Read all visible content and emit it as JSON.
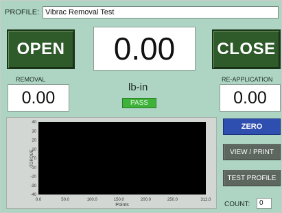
{
  "profile": {
    "label": "PROFILE:",
    "value": "Vibrac Removal Test"
  },
  "buttons": {
    "open": "OPEN",
    "close": "CLOSE",
    "zero": "ZERO",
    "view_print": "VIEW / PRINT",
    "test_profile": "TEST PROFILE"
  },
  "main_display": {
    "value": "0.00"
  },
  "removal": {
    "label": "REMOVAL",
    "value": "0.00"
  },
  "reapplication": {
    "label": "RE-APPLICATION",
    "value": "0.00"
  },
  "unit": "lb-in",
  "status": {
    "text": "PASS",
    "color": "#3fb23a"
  },
  "count": {
    "label": "COUNT:",
    "value": "0"
  },
  "colors": {
    "panel": "#aed5c3",
    "button_green": "#2f5a2a",
    "zero_blue": "#2f4fb0",
    "plot_bg": "#000000"
  },
  "chart_data": {
    "type": "line",
    "xlabel": "Points",
    "ylabel": "TORQUE",
    "xlim": [
      0,
      312
    ],
    "ylim": [
      -40,
      40
    ],
    "x_ticks": [
      "0.0",
      "50.0",
      "100.0",
      "150.0",
      "200.0",
      "250.0",
      "312.0"
    ],
    "x_tick_values": [
      0,
      50,
      100,
      150,
      200,
      250,
      312
    ],
    "y_ticks": [
      "40",
      "30",
      "20",
      "10",
      "0",
      "-10",
      "-20",
      "-30",
      "-40"
    ],
    "y_tick_values": [
      40,
      30,
      20,
      10,
      0,
      -10,
      -20,
      -30,
      -40
    ],
    "series": [],
    "grid": false
  }
}
